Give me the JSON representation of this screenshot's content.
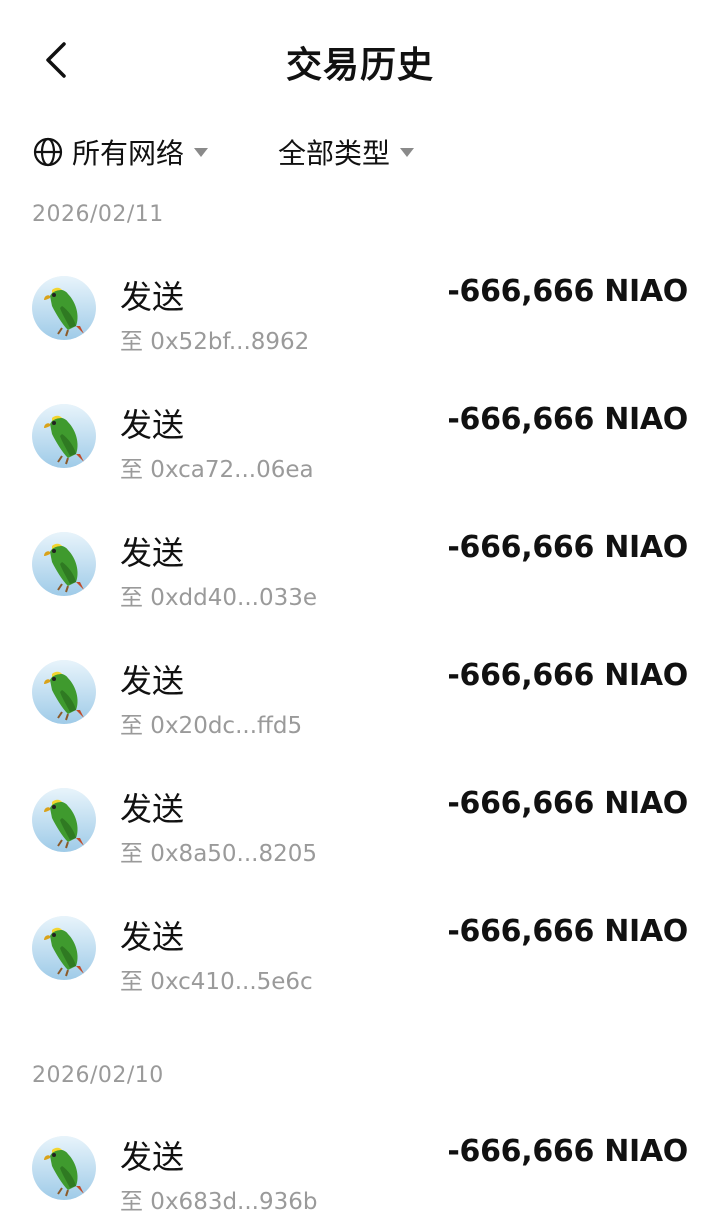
{
  "header": {
    "title": "交易历史"
  },
  "filters": {
    "network_label": "所有网络",
    "type_label": "全部类型"
  },
  "groups": [
    {
      "date": "2026/02/11",
      "transactions": [
        {
          "type": "发送",
          "address": "至 0x52bf...8962",
          "amount": "-666,666 NIAO"
        },
        {
          "type": "发送",
          "address": "至 0xca72...06ea",
          "amount": "-666,666 NIAO"
        },
        {
          "type": "发送",
          "address": "至 0xdd40...033e",
          "amount": "-666,666 NIAO"
        },
        {
          "type": "发送",
          "address": "至 0x20dc...ffd5",
          "amount": "-666,666 NIAO"
        },
        {
          "type": "发送",
          "address": "至 0x8a50...8205",
          "amount": "-666,666 NIAO"
        },
        {
          "type": "发送",
          "address": "至 0xc410...5e6c",
          "amount": "-666,666 NIAO"
        }
      ]
    },
    {
      "date": "2026/02/10",
      "transactions": [
        {
          "type": "发送",
          "address": "至 0x683d...936b",
          "amount": "-666,666 NIAO"
        }
      ]
    }
  ],
  "icons": {
    "back": "chevron-left-icon",
    "network": "globe-icon",
    "dropdown": "caret-down-icon",
    "token": "parrot-token-icon"
  },
  "colors": {
    "text_primary": "#111111",
    "text_secondary": "#9a9a9a",
    "caret": "#8a8a8a",
    "avatar_sky": "#bfe0f2",
    "parrot_green": "#3f9a2e"
  }
}
